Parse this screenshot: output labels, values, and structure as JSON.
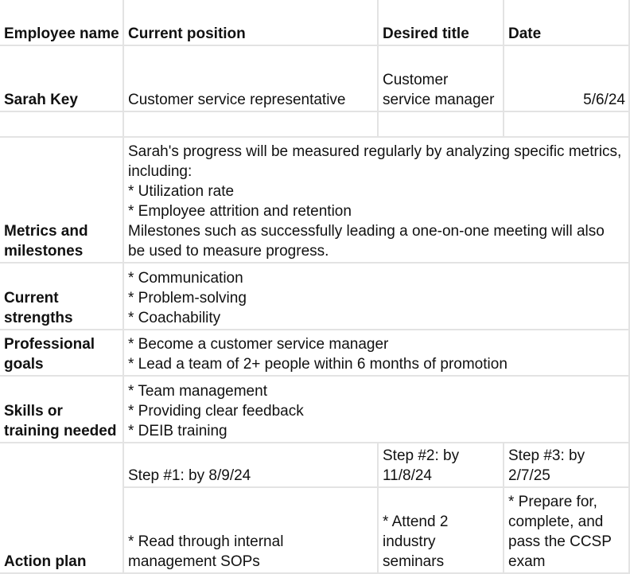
{
  "header": {
    "employee_name": "Employee name",
    "current_position": "Current position",
    "desired_title": "Desired title",
    "date": "Date"
  },
  "employee": {
    "name": "Sarah Key",
    "current_position": "Customer service representative",
    "desired_title": "Customer service manager",
    "date": "5/6/24"
  },
  "rows": {
    "metrics": {
      "label": "Metrics and milestones",
      "lines": [
        "Sarah's progress will be measured regularly by analyzing specific metrics, including:",
        "* Utilization rate",
        "* Employee attrition and retention",
        "Milestones such as successfully leading a one-on-one meeting will also be used to measure progress."
      ]
    },
    "strengths": {
      "label": "Current strengths",
      "lines": [
        "* Communication",
        "* Problem-solving",
        "* Coachability"
      ]
    },
    "goals": {
      "label": "Professional goals",
      "lines": [
        "* Become a customer service manager",
        "* Lead a team of 2+ people within 6 months of promotion"
      ]
    },
    "skills": {
      "label": "Skills or training needed",
      "lines": [
        "* Team management",
        "* Providing clear feedback",
        "* DEIB training"
      ]
    },
    "action_plan": {
      "label": "Action plan",
      "steps": [
        {
          "title": "Step #1: by 8/9/24",
          "detail": "* Read through internal management SOPs"
        },
        {
          "title": "Step #2: by 11/8/24",
          "detail": "* Attend 2 industry seminars"
        },
        {
          "title": "Step #3: by 2/7/25",
          "detail": "* Prepare for, complete, and pass the CCSP exam"
        }
      ]
    }
  }
}
